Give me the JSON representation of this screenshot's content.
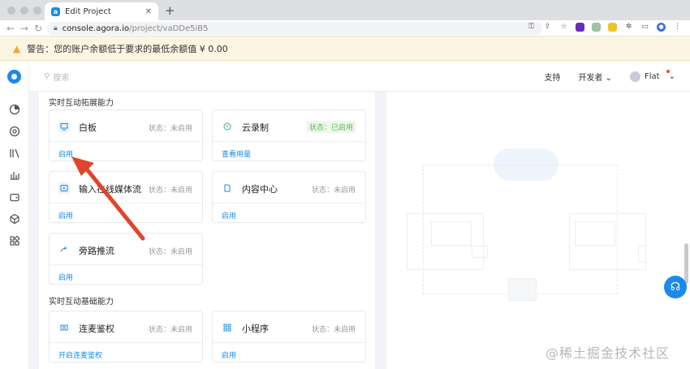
{
  "browser": {
    "tab_title": "Edit Project",
    "url_domain": "console.agora.io",
    "url_path": "/project/vaDDe5iB5",
    "colors": {
      "accent": "#1b8ae8"
    }
  },
  "warning": {
    "text": "警告：您的账户余额低于要求的最低余额值 ¥ 0.00"
  },
  "appbar": {
    "search_placeholder": "搜索",
    "support": "支持",
    "developer": "开发者",
    "user": "Flat"
  },
  "sections": [
    {
      "title": "实时互动拓展能力"
    },
    {
      "title": "实时互动基础能力"
    }
  ],
  "cards": [
    {
      "name": "白板",
      "status": "状态：未启用",
      "link": "启用"
    },
    {
      "name": "云录制",
      "status": "状态：已启用",
      "link": "查看用量"
    },
    {
      "name": "输入在线媒体流",
      "status": "状态：未启用",
      "link": "启用"
    },
    {
      "name": "内容中心",
      "status": "状态：未启用",
      "link": "启用"
    },
    {
      "name": "旁路推流",
      "status": "状态：未启用",
      "link": "启用"
    },
    {
      "name": "连麦鉴权",
      "status": "状态：未启用",
      "link": "开启连麦鉴权"
    },
    {
      "name": "小程序",
      "status": "状态：未启用",
      "link": "启用"
    }
  ],
  "watermark": "@稀土掘金技术社区"
}
